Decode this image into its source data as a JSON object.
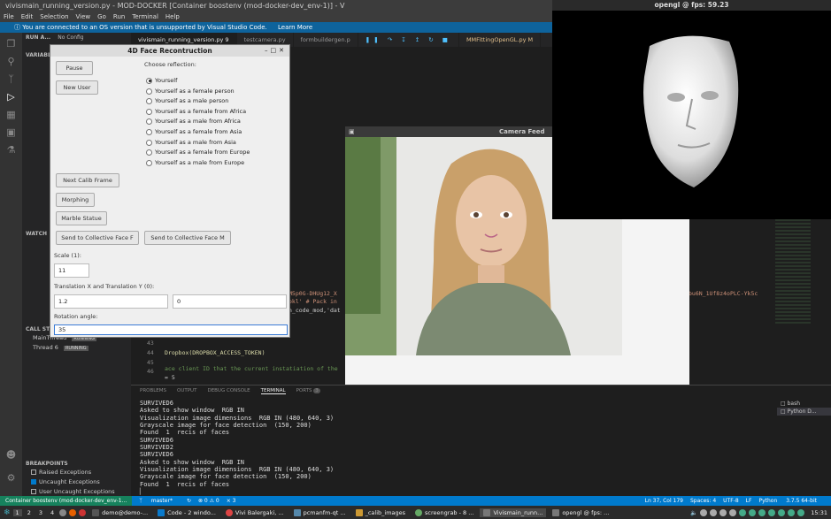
{
  "vscode": {
    "title": "vivismain_running_version.py - MOD-DOCKER [Container boostenv (mod-docker-dev_env-1)] - V",
    "menu": [
      "File",
      "Edit",
      "Selection",
      "View",
      "Go",
      "Run",
      "Terminal",
      "Help"
    ],
    "banner_text": "You are connected to an OS version that is unsupported by Visual Studio Code.",
    "banner_link": "Learn More",
    "run_label": "RUN A...",
    "config_label": "No Config",
    "tabs": [
      "vivismain_running_version.py 9",
      "testcamera.py",
      "formbuildergen.p",
      "MMFittingOpenGL.py M"
    ],
    "sidebar": {
      "variables": "VARIABLES",
      "watch": "WATCH",
      "callstack": "CALL STACK",
      "thread_main": "MainThread",
      "thread_6": "Thread 6",
      "running": "RUNNING",
      "breakpoints": "BREAKPOINTS",
      "bp_items": [
        "Raised Exceptions",
        "Uncaught Exceptions",
        "User Uncaught Exceptions"
      ]
    },
    "code": {
      "l1": "M5p0G-DHUg12_X",
      "l2": "okl'  # Pack in",
      "l3": "h_code_mod,'dat",
      "l4": "bu6N_1Uf8z4oPLC-Yk5c",
      "ln43": "43",
      "ln44": "44",
      "ln45": "45",
      "ln46": "46",
      "c43": "",
      "c44": "Dropbox(DROPBOX_ACCESS_TOKEN)",
      "c45": "",
      "c46": "ace client ID that the current instatiation of the",
      "c47": "= 5"
    },
    "panel_tabs": [
      "PROBLEMS",
      "OUTPUT",
      "DEBUG CONSOLE",
      "TERMINAL",
      "PORTS"
    ],
    "ports_badge": "3",
    "terminal": "SURVIVED6\nAsked to show window  RGB IN\nVisualization image dimensions  RGB IN (480, 640, 3)\nGrayscale image for face detection  (150, 200)\nFound  1  recis of faces\nSURVIVED6\nSURVIVED2\nSURVIVED6\nAsked to show window  RGB IN\nVisualization image dimensions  RGB IN (480, 640, 3)\nGrayscale image for face detection  (150, 200)\nFound  1  recis of faces\n▏",
    "term_list": [
      "bash",
      "Python D..."
    ],
    "status": {
      "remote": "Container boostenv (mod-docker-dev_env-1...",
      "branch": "master*",
      "sync": "↻",
      "errors": "⊗ 0 ⚠ 0",
      "ports": "⨯ 3",
      "pos": "Ln 37, Col 179",
      "spaces": "Spaces: 4",
      "enc": "UTF-8",
      "eol": "LF",
      "lang": "Python",
      "ver": "3.7.5 64-bit"
    }
  },
  "dialog": {
    "title": "4D Face Recontruction",
    "pause": "Pause",
    "new_user": "New User",
    "choose": "Choose reflection:",
    "options": [
      "Yourself",
      "Yourself as a female person",
      "Yourself as a male person",
      "Yourself as a female from Africa",
      "Yourself as a male from Africa",
      "Yourself as a female from Asia",
      "Yourself as a male from Asia",
      "Yourself as a female from Europe",
      "Yourself as a male from Europe"
    ],
    "next_calib": "Next Calib Frame",
    "morphing": "Morphing",
    "marble": "Marble Statue",
    "send_f": "Send to Collective Face F",
    "send_m": "Send to Collective Face M",
    "scale_label": "Scale (1):",
    "scale_val": "11",
    "trans_label": "Translation X and Translation Y (0):",
    "tx": "1.2",
    "ty": "0",
    "rot_label": "Rotation angle:",
    "rot_val": "35"
  },
  "camera": {
    "title": "Camera Feed"
  },
  "opengl": {
    "title": "opengl @ fps: 59.23"
  },
  "taskbar": {
    "workspaces": [
      "1",
      "2",
      "3",
      "4"
    ],
    "items": [
      "demo@demo-...",
      "Code - 2 windo...",
      "Vivi Balergaki, ...",
      "pcmanfm-qt ...",
      "_calib_images",
      "screengrab - 8 ...",
      "Vivismain_runn...",
      "opengl @ fps: ..."
    ],
    "clock": "15:31"
  }
}
